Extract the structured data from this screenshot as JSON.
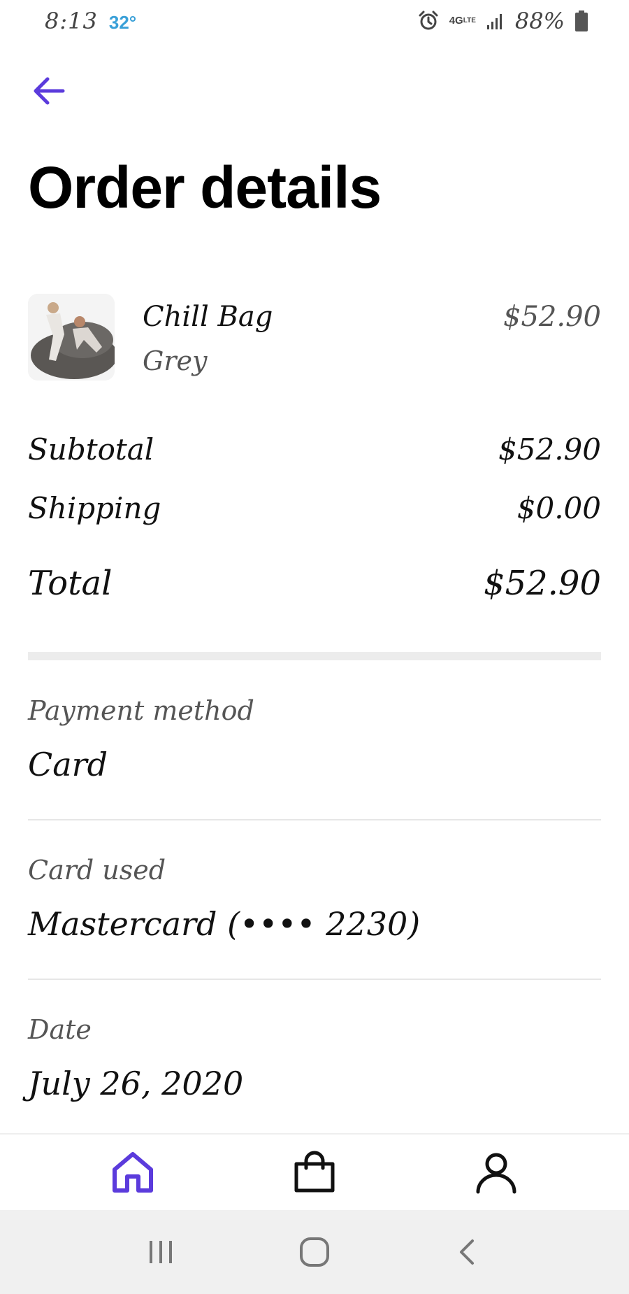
{
  "status_bar": {
    "time": "8:13",
    "temperature": "32°",
    "network": "4G",
    "network_sub": "LTE",
    "battery": "88%",
    "icons": [
      "alarm-icon",
      "lte-icon",
      "signal-icon",
      "battery-icon"
    ]
  },
  "header": {
    "back_icon": "arrow-left-icon",
    "title": "Order details"
  },
  "order_item": {
    "name": "Chill Bag",
    "variant": "Grey",
    "price": "$52.90"
  },
  "summary": {
    "subtotal_label": "Subtotal",
    "subtotal_value": "$52.90",
    "shipping_label": "Shipping",
    "shipping_value": "$0.00",
    "total_label": "Total",
    "total_value": "$52.90"
  },
  "details": {
    "payment_method_label": "Payment method",
    "payment_method_value": "Card",
    "card_used_label": "Card used",
    "card_used_value": "Mastercard (•••• 2230)",
    "date_label": "Date",
    "date_value": "July 26, 2020"
  },
  "bottom_nav": {
    "items": [
      {
        "icon": "home-icon",
        "active": true
      },
      {
        "icon": "shopping-bag-icon",
        "active": false
      },
      {
        "icon": "profile-icon",
        "active": false
      }
    ]
  },
  "system_nav": {
    "items": [
      "recent-apps-icon",
      "home-circle-icon",
      "back-chevron-icon"
    ]
  },
  "colors": {
    "accent": "#5b3bdc",
    "temperature": "#3aa0d8",
    "text_primary": "#111111",
    "text_secondary": "#555555",
    "divider": "#e6e6e6",
    "system_nav_bg": "#f0f0f0"
  }
}
